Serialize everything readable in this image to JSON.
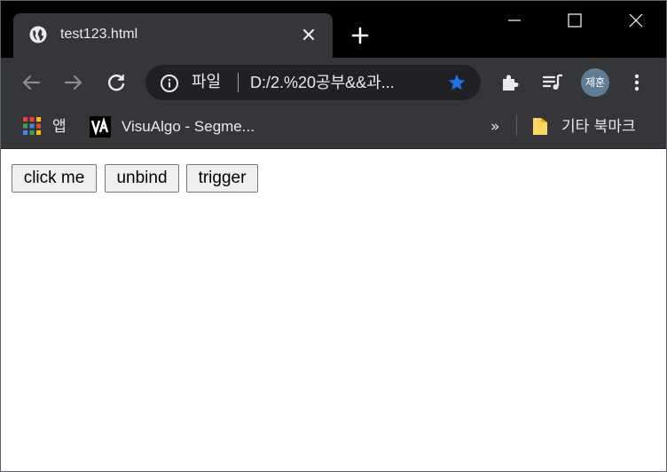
{
  "tab": {
    "title": "test123.html"
  },
  "omnibox": {
    "scheme_label": "파일",
    "url": "D:/2.%20공부&&과..."
  },
  "profile": {
    "initials": "제훈"
  },
  "bookmarks": {
    "apps_label": "앱",
    "items": [
      {
        "label": "VisuAlgo - Segme..."
      }
    ],
    "overflow_label": "»",
    "other_label": "기타 북마크"
  },
  "page": {
    "buttons": [
      {
        "label": "click me"
      },
      {
        "label": "unbind"
      },
      {
        "label": "trigger"
      }
    ]
  },
  "colors": {
    "accent_star": "#1a73e8",
    "chrome_dark": "#35363a",
    "omnibox_bg": "#202124"
  }
}
